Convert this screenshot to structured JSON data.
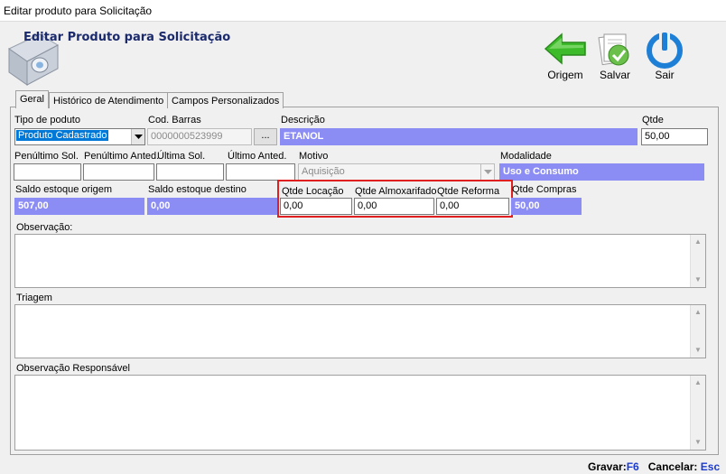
{
  "window": {
    "title": "Editar produto para Solicitação"
  },
  "header": {
    "title": "Editar Produto para Solicitação"
  },
  "toolbar": {
    "origem_label": "Origem",
    "salvar_label": "Salvar",
    "sair_label": "Sair"
  },
  "tabs": [
    {
      "label": "Geral"
    },
    {
      "label": "Histórico de Atendimento"
    },
    {
      "label": "Campos Personalizados"
    }
  ],
  "form": {
    "tipo_produto": {
      "label": "Tipo de poduto",
      "value": "Produto Cadastrado"
    },
    "cod_barras": {
      "label": "Cod. Barras",
      "value": "0000000523999",
      "button": "..."
    },
    "descricao": {
      "label": "Descrição",
      "value": "ETANOL"
    },
    "qtde": {
      "label": "Qtde",
      "value": "50,00"
    },
    "penultimo_sol": {
      "label": "Penúltimo Sol.",
      "value": ""
    },
    "penultimo_anted": {
      "label": "Penúltimo Anted.",
      "value": ""
    },
    "ultima_sol": {
      "label": "Última Sol.",
      "value": ""
    },
    "ultimo_anted": {
      "label": "Último Anted.",
      "value": ""
    },
    "motivo": {
      "label": "Motivo",
      "value": "Aquisição"
    },
    "modalidade": {
      "label": "Modalidade",
      "value": "Uso e Consumo"
    },
    "saldo_origem": {
      "label": "Saldo estoque origem",
      "value": "507,00"
    },
    "saldo_destino": {
      "label": "Saldo estoque destino",
      "value": "0,00"
    },
    "qtde_locacao": {
      "label": "Qtde Locação",
      "value": "0,00"
    },
    "qtde_almoxarifado": {
      "label": "Qtde Almoxarifado",
      "value": "0,00"
    },
    "qtde_reforma": {
      "label": "Qtde Reforma",
      "value": "0,00"
    },
    "qtde_compras": {
      "label": "Qtde Compras",
      "value": "50,00"
    },
    "observacao": {
      "label": "Observação:"
    },
    "triagem": {
      "label": "Triagem"
    },
    "observacao_responsavel": {
      "label": "Observação Responsável"
    }
  },
  "status": {
    "gravar_label": "Gravar:",
    "gravar_key": "F6",
    "cancelar_label": "Cancelar:",
    "cancelar_key": "Esc"
  },
  "colors": {
    "highlight": "#8c8cf5",
    "selection": "#0078d7",
    "title": "#1a2a6c",
    "accent_red": "#e02020"
  }
}
